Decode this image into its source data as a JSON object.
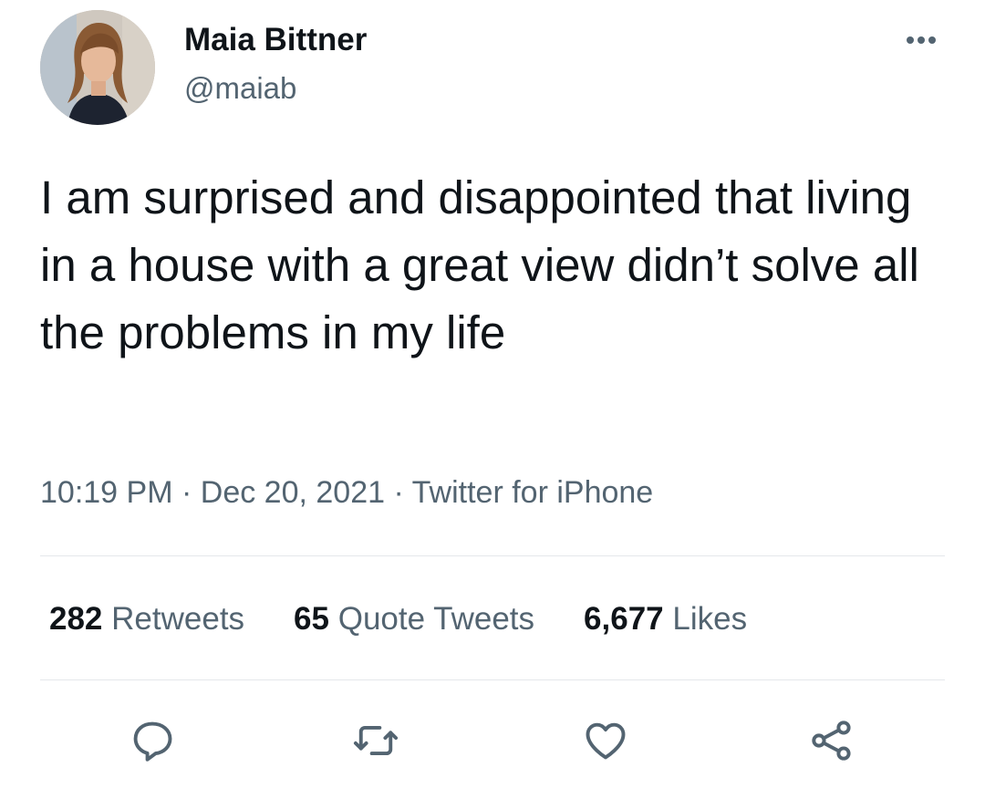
{
  "author": {
    "display_name": "Maia Bittner",
    "handle": "@maiab"
  },
  "tweet": {
    "text": "I am surprised and disappointed that living in a house with a great view didn’t solve all the problems in my life",
    "time": "10:19 PM",
    "dot1": "·",
    "date": "Dec 20, 2021",
    "dot2": "·",
    "source": "Twitter for iPhone"
  },
  "stats": {
    "retweets_count": "282",
    "retweets_label": "Retweets",
    "quotes_count": "65",
    "quotes_label": "Quote Tweets",
    "likes_count": "6,677",
    "likes_label": "Likes"
  },
  "icons": {
    "more": "more-horizontal-icon",
    "reply": "reply-icon",
    "retweet": "retweet-icon",
    "like": "heart-icon",
    "share": "share-icon"
  },
  "colors": {
    "text_primary": "#0f1419",
    "text_secondary": "#536471",
    "divider": "#e5e8eb"
  }
}
